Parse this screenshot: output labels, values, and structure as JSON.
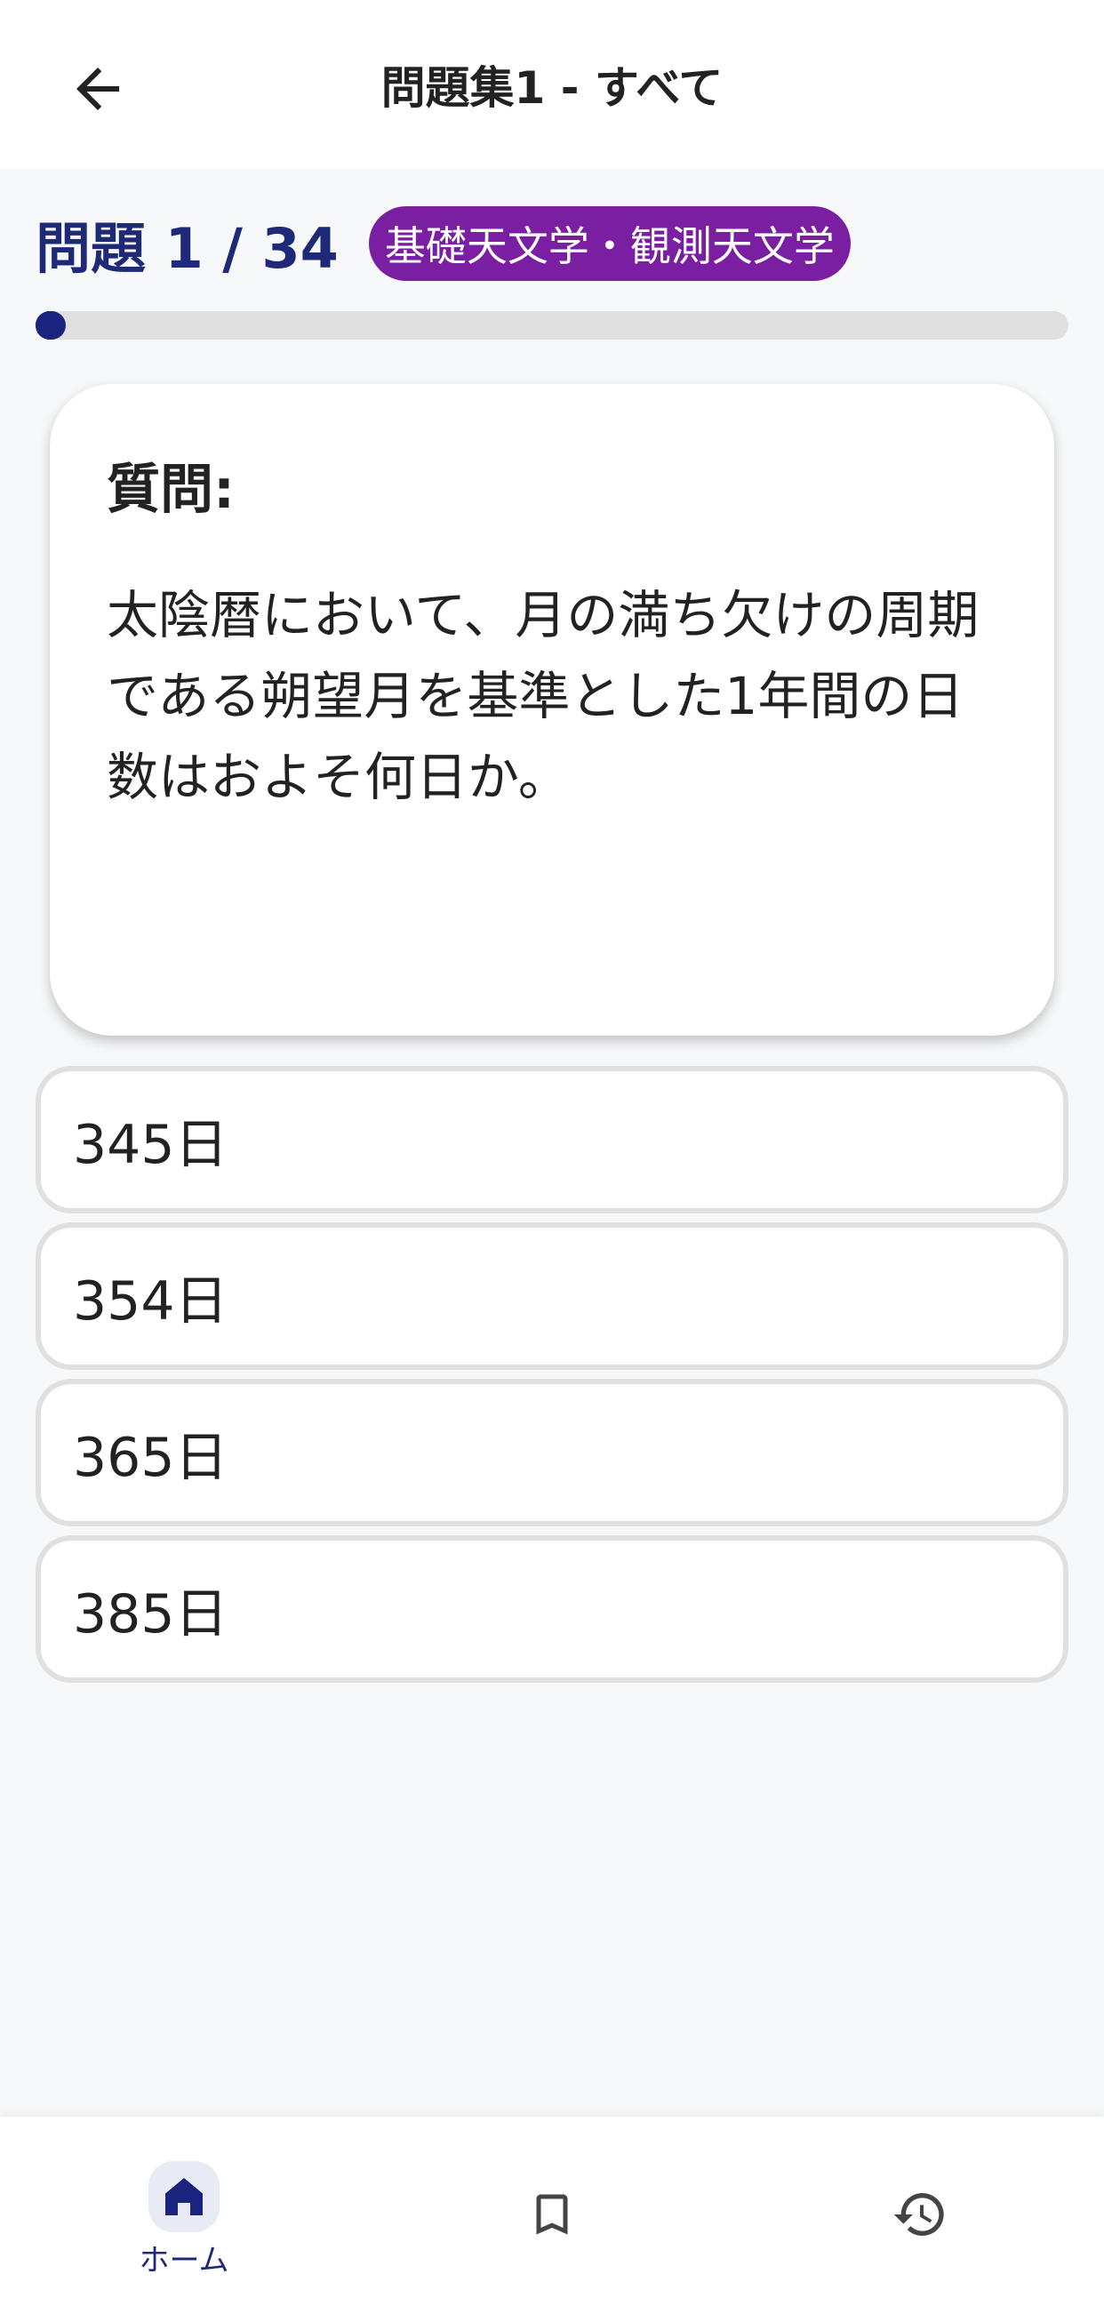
{
  "app_bar": {
    "title": "問題集1 - すべて",
    "back_icon": "arrow-back-icon"
  },
  "quiz": {
    "counter": "問題 1 / 34",
    "category": "基礎天文学・観測天文学",
    "progress": 0.0294,
    "accent_color": "#1e2a78",
    "badge_color": "#7b1fa2"
  },
  "question": {
    "label": "質問:",
    "text": "太陰暦において、月の満ち欠けの周期である朔望月を基準とした1年間の日数はおよそ何日か。"
  },
  "options": [
    {
      "label": "345日"
    },
    {
      "label": "354日"
    },
    {
      "label": "365日"
    },
    {
      "label": "385日"
    }
  ],
  "bottom_nav": {
    "home_label": "ホーム",
    "home_icon": "home-icon",
    "bookmark_icon": "bookmark-icon",
    "history_icon": "history-icon"
  }
}
